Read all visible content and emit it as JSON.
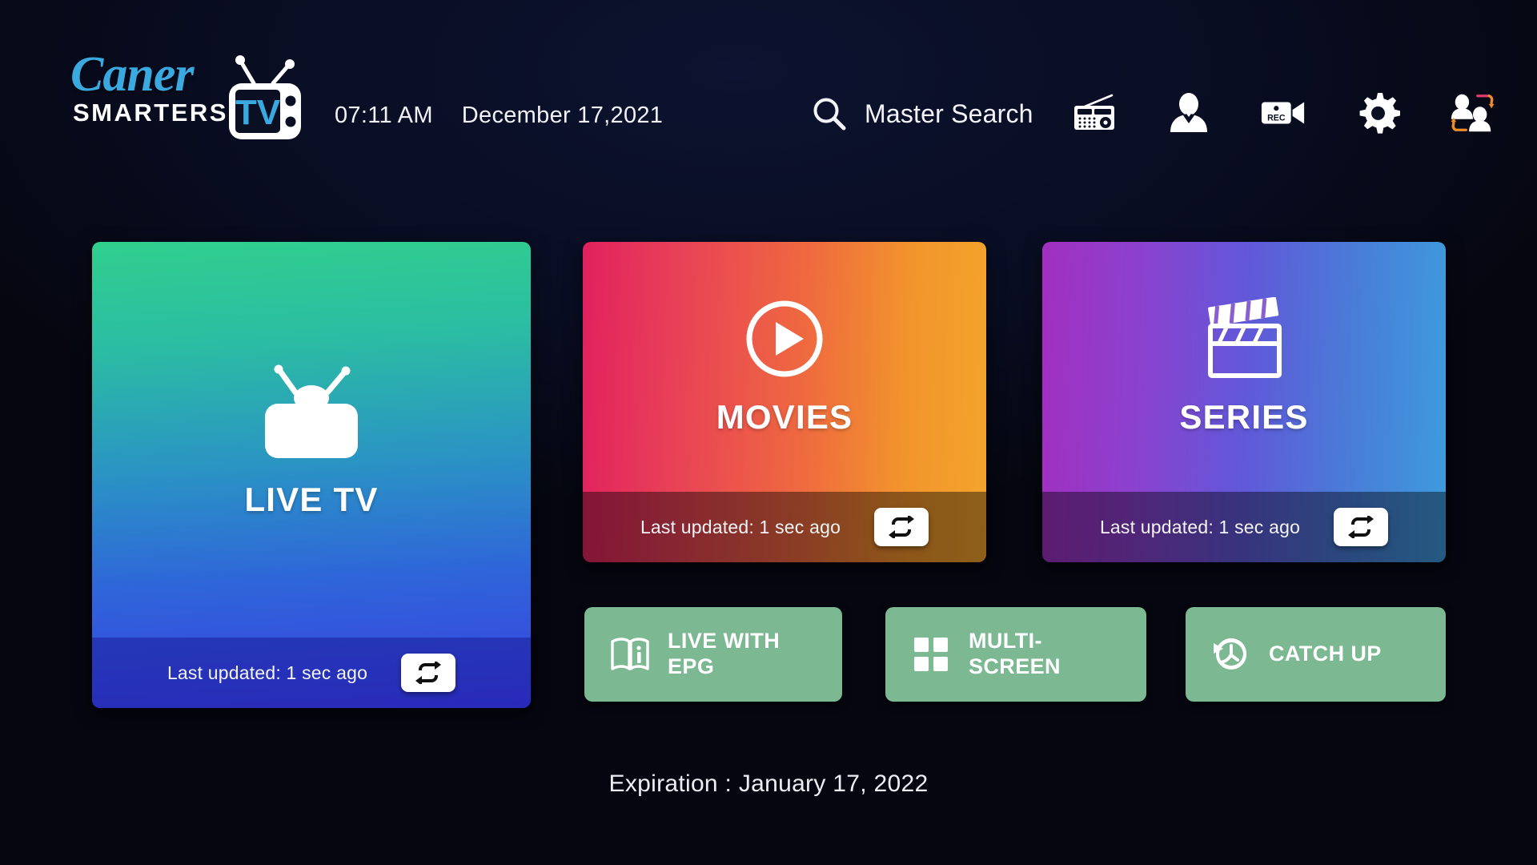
{
  "app": {
    "background_color": "#05060f",
    "accent_color": "#3aa9e0"
  },
  "header": {
    "logo": {
      "brand_top": "Caner",
      "brand_bottom": "SMARTERS",
      "badge_text": "TV",
      "brand_color": "#3aa9e0"
    },
    "time": "07:11 AM",
    "date": "December 17,2021",
    "search": {
      "icon": "search-icon",
      "label": "Master Search"
    },
    "icons": [
      {
        "name": "radio-icon",
        "label": "Radio"
      },
      {
        "name": "account-icon",
        "label": "Account"
      },
      {
        "name": "rec-camera-icon",
        "label": "REC",
        "badge_text": "REC"
      },
      {
        "name": "gear-icon",
        "label": "Settings"
      },
      {
        "name": "switch-user-icon",
        "label": "Switch User"
      }
    ]
  },
  "main": {
    "cards": [
      {
        "id": "livetv",
        "title": "LIVE TV",
        "icon": "tv-play-icon",
        "footer_text": "Last updated: 1 sec ago",
        "refresh_icon": "refresh-loop-icon",
        "gradient_from": "#30cf8e",
        "gradient_to": "#3a3fe0"
      },
      {
        "id": "movies",
        "title": "MOVIES",
        "icon": "play-circle-icon",
        "footer_text": "Last updated: 1 sec ago",
        "refresh_icon": "refresh-loop-icon",
        "gradient_from": "#e2215f",
        "gradient_to": "#f3a42b"
      },
      {
        "id": "series",
        "title": "SERIES",
        "icon": "clapperboard-icon",
        "footer_text": "Last updated: 1 sec ago",
        "refresh_icon": "refresh-loop-icon",
        "gradient_from": "#a22fc0",
        "gradient_to": "#3e9bdd"
      }
    ],
    "quick_buttons": [
      {
        "id": "epg",
        "label": "LIVE WITH EPG",
        "icon": "book-info-icon",
        "color": "#7cb992"
      },
      {
        "id": "multi",
        "label": "MULTI-SCREEN",
        "icon": "grid-four-icon",
        "color": "#7cb992"
      },
      {
        "id": "catch",
        "label": "CATCH UP",
        "icon": "history-clock-icon",
        "color": "#7cb992"
      }
    ]
  },
  "footer": {
    "expiration": "Expiration : January 17, 2022"
  }
}
